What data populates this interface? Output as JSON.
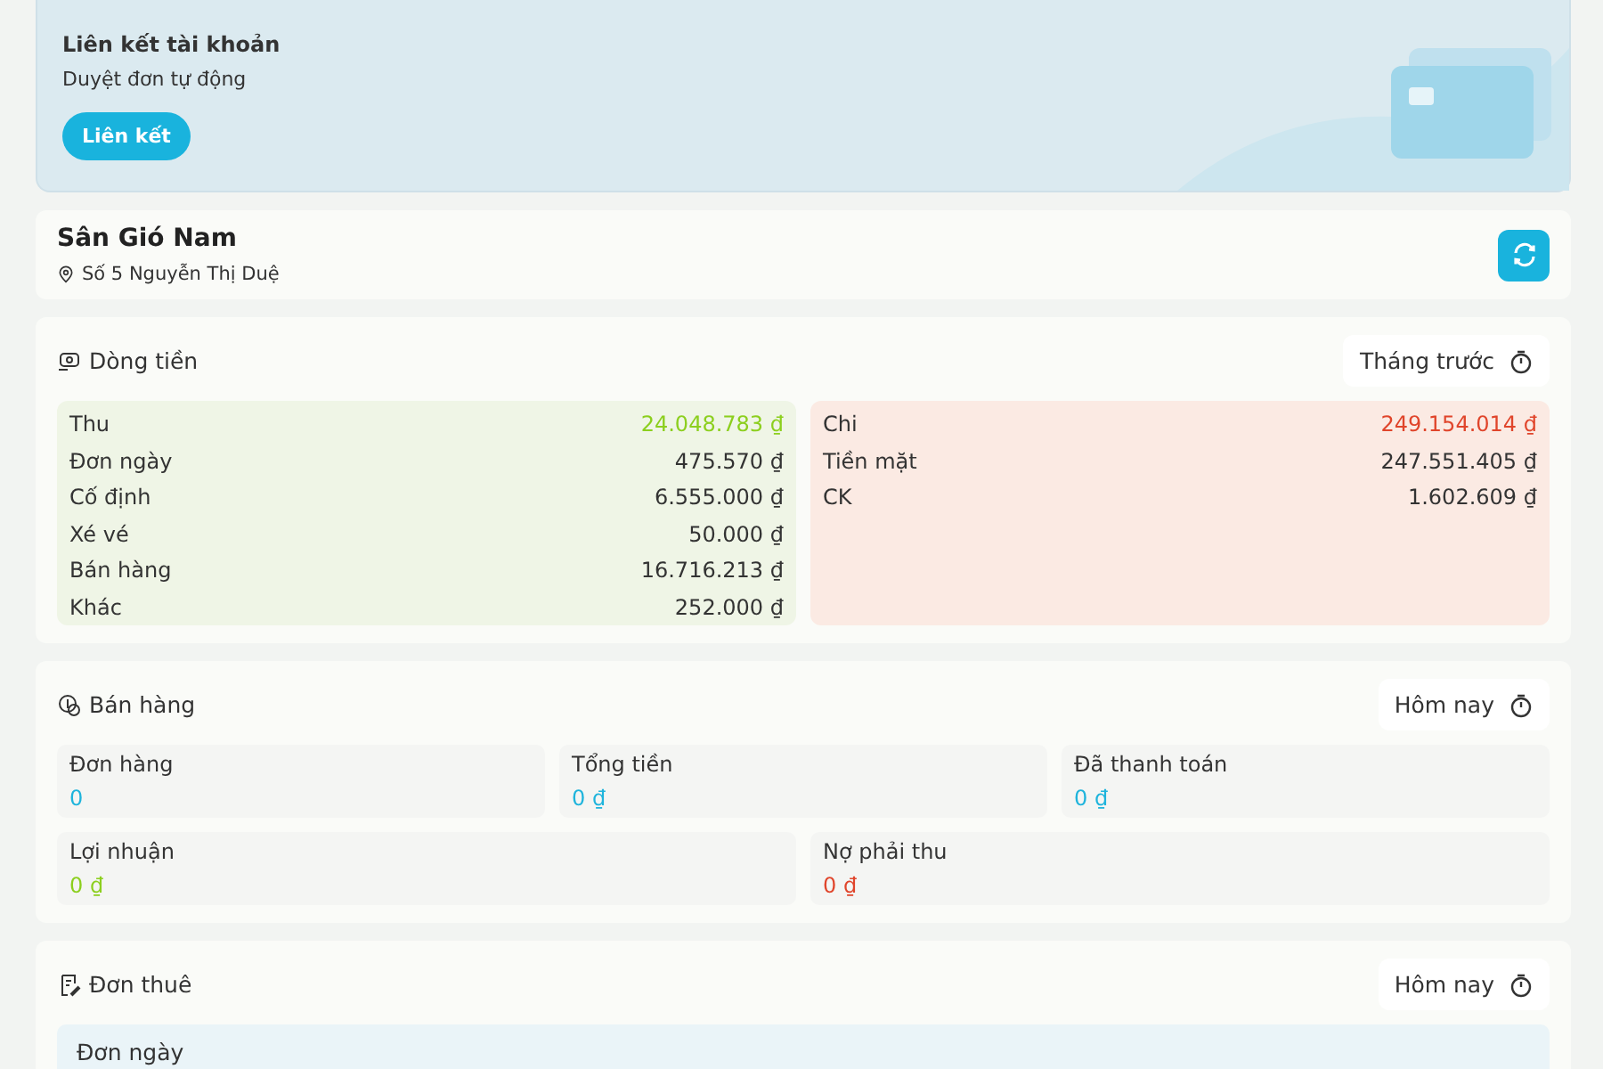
{
  "banner": {
    "title": "Liên kết tài khoản",
    "subtitle": "Duyệt đơn tự động",
    "button": "Liên kết"
  },
  "venue": {
    "name": "Sân Gió Nam",
    "address": "Số 5 Nguyễn Thị Duệ"
  },
  "cashflow": {
    "title": "Dòng tiền",
    "period": "Tháng trước",
    "income": {
      "label": "Thu",
      "total": "24.048.783 ₫",
      "color": "#8ccf1e",
      "rows": [
        {
          "label": "Đơn ngày",
          "value": "475.570 ₫"
        },
        {
          "label": "Cố định",
          "value": "6.555.000 ₫"
        },
        {
          "label": "Xé vé",
          "value": "50.000 ₫"
        },
        {
          "label": "Bán hàng",
          "value": "16.716.213 ₫"
        },
        {
          "label": "Khác",
          "value": "252.000 ₫"
        }
      ]
    },
    "expense": {
      "label": "Chi",
      "total": "249.154.014 ₫",
      "color": "#e0452b",
      "rows": [
        {
          "label": "Tiền mặt",
          "value": "247.551.405 ₫"
        },
        {
          "label": "CK",
          "value": "1.602.609 ₫"
        }
      ]
    }
  },
  "sales": {
    "title": "Bán hàng",
    "period": "Hôm nay",
    "stats": [
      {
        "label": "Đơn hàng",
        "value": "0",
        "color": "#1eb4dc"
      },
      {
        "label": "Tổng tiền",
        "value": "0 ₫",
        "color": "#1eb4dc"
      },
      {
        "label": "Đã thanh toán",
        "value": "0 ₫",
        "color": "#1eb4dc"
      },
      {
        "label": "Lợi nhuận",
        "value": "0 ₫",
        "color": "#8ccf1e"
      },
      {
        "label": "Nợ phải thu",
        "value": "0 ₫",
        "color": "#e0452b"
      }
    ]
  },
  "rentals": {
    "title": "Đơn thuê",
    "period": "Hôm nay",
    "groups": [
      {
        "label": "Đơn ngày"
      }
    ]
  }
}
